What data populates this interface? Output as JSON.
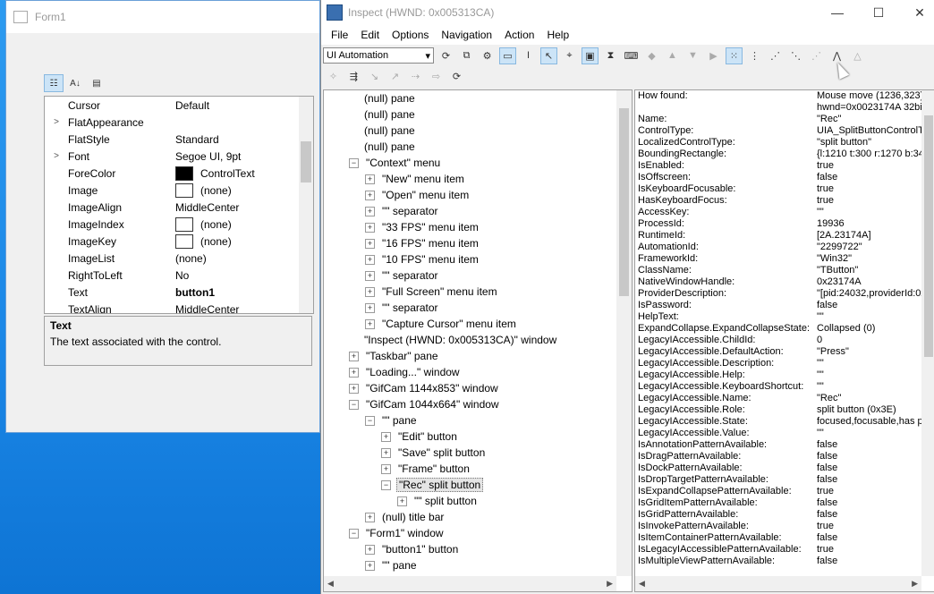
{
  "form1": {
    "title": "Form1",
    "properties": [
      {
        "name": "Cursor",
        "value": "Default",
        "expand": "",
        "swatch": "",
        "bold": false
      },
      {
        "name": "FlatAppearance",
        "value": "",
        "expand": ">",
        "swatch": "",
        "bold": false
      },
      {
        "name": "FlatStyle",
        "value": "Standard",
        "expand": "",
        "swatch": "",
        "bold": false
      },
      {
        "name": "Font",
        "value": "Segoe UI, 9pt",
        "expand": ">",
        "swatch": "",
        "bold": false
      },
      {
        "name": "ForeColor",
        "value": "ControlText",
        "expand": "",
        "swatch": "black",
        "bold": false
      },
      {
        "name": "Image",
        "value": "(none)",
        "expand": "",
        "swatch": "white",
        "bold": false
      },
      {
        "name": "ImageAlign",
        "value": "MiddleCenter",
        "expand": "",
        "swatch": "",
        "bold": false
      },
      {
        "name": "ImageIndex",
        "value": "(none)",
        "expand": "",
        "swatch": "white",
        "bold": false
      },
      {
        "name": "ImageKey",
        "value": "(none)",
        "expand": "",
        "swatch": "white",
        "bold": false
      },
      {
        "name": "ImageList",
        "value": "(none)",
        "expand": "",
        "swatch": "",
        "bold": false
      },
      {
        "name": "RightToLeft",
        "value": "No",
        "expand": "",
        "swatch": "",
        "bold": false
      },
      {
        "name": "Text",
        "value": "button1",
        "expand": "",
        "swatch": "",
        "bold": true
      },
      {
        "name": "TextAlign",
        "value": "MiddleCenter",
        "expand": "",
        "swatch": "",
        "bold": false
      }
    ],
    "description_title": "Text",
    "description_text": "The text associated with the control."
  },
  "inspect": {
    "title": "Inspect  (HWND: 0x005313CA)",
    "menu": [
      "File",
      "Edit",
      "Options",
      "Navigation",
      "Action",
      "Help"
    ],
    "mode": "UI Automation",
    "tree": [
      {
        "indent": 0,
        "exp": "",
        "label": "(null) pane",
        "sel": false
      },
      {
        "indent": 0,
        "exp": "",
        "label": "(null) pane",
        "sel": false
      },
      {
        "indent": 0,
        "exp": "",
        "label": "(null) pane",
        "sel": false
      },
      {
        "indent": 0,
        "exp": "",
        "label": "(null) pane",
        "sel": false
      },
      {
        "indent": 0,
        "exp": "−",
        "label": "\"Context\" menu",
        "sel": false
      },
      {
        "indent": 1,
        "exp": "+",
        "label": "\"New\" menu item",
        "sel": false
      },
      {
        "indent": 1,
        "exp": "+",
        "label": "\"Open\" menu item",
        "sel": false
      },
      {
        "indent": 1,
        "exp": "+",
        "label": "\"\" separator",
        "sel": false
      },
      {
        "indent": 1,
        "exp": "+",
        "label": "\"33 FPS\" menu item",
        "sel": false
      },
      {
        "indent": 1,
        "exp": "+",
        "label": "\"16 FPS\" menu item",
        "sel": false
      },
      {
        "indent": 1,
        "exp": "+",
        "label": "\"10 FPS\" menu item",
        "sel": false
      },
      {
        "indent": 1,
        "exp": "+",
        "label": "\"\" separator",
        "sel": false
      },
      {
        "indent": 1,
        "exp": "+",
        "label": "\"Full Screen\" menu item",
        "sel": false
      },
      {
        "indent": 1,
        "exp": "+",
        "label": "\"\" separator",
        "sel": false
      },
      {
        "indent": 1,
        "exp": "+",
        "label": "\"Capture Cursor\" menu item",
        "sel": false
      },
      {
        "indent": 0,
        "exp": "",
        "label": "\"Inspect  (HWND: 0x005313CA)\" window",
        "sel": false
      },
      {
        "indent": 0,
        "exp": "+",
        "label": "\"Taskbar\" pane",
        "sel": false
      },
      {
        "indent": 0,
        "exp": "+",
        "label": "\"Loading...\" window",
        "sel": false
      },
      {
        "indent": 0,
        "exp": "+",
        "label": "\"GifCam 1144x853\" window",
        "sel": false
      },
      {
        "indent": 0,
        "exp": "−",
        "label": "\"GifCam 1044x664\" window",
        "sel": false
      },
      {
        "indent": 1,
        "exp": "−",
        "label": "\"\" pane",
        "sel": false
      },
      {
        "indent": 2,
        "exp": "+",
        "label": "\"Edit\" button",
        "sel": false
      },
      {
        "indent": 2,
        "exp": "+",
        "label": "\"Save\" split button",
        "sel": false
      },
      {
        "indent": 2,
        "exp": "+",
        "label": "\"Frame\" button",
        "sel": false
      },
      {
        "indent": 2,
        "exp": "−",
        "label": "\"Rec\" split button",
        "sel": true
      },
      {
        "indent": 3,
        "exp": "+",
        "label": "\"\" split button",
        "sel": false
      },
      {
        "indent": 1,
        "exp": "+",
        "label": "(null) title bar",
        "sel": false
      },
      {
        "indent": 0,
        "exp": "−",
        "label": "\"Form1\" window",
        "sel": false
      },
      {
        "indent": 1,
        "exp": "+",
        "label": "\"button1\" button",
        "sel": false
      },
      {
        "indent": 1,
        "exp": "+",
        "label": "\"\" pane",
        "sel": false
      }
    ],
    "props": [
      {
        "k": "How found:",
        "v": "Mouse move (1236,323)"
      },
      {
        "k": "",
        "v": "hwnd=0x0023174A 32bit"
      },
      {
        "k": "Name:",
        "v": "\"Rec\""
      },
      {
        "k": "ControlType:",
        "v": "UIA_SplitButtonControlTy"
      },
      {
        "k": "LocalizedControlType:",
        "v": "\"split button\""
      },
      {
        "k": "BoundingRectangle:",
        "v": "{l:1210 t:300 r:1270 b:34"
      },
      {
        "k": "IsEnabled:",
        "v": "true"
      },
      {
        "k": "IsOffscreen:",
        "v": "false"
      },
      {
        "k": "IsKeyboardFocusable:",
        "v": "true"
      },
      {
        "k": "HasKeyboardFocus:",
        "v": "true"
      },
      {
        "k": "AccessKey:",
        "v": "\"\""
      },
      {
        "k": "ProcessId:",
        "v": "19936"
      },
      {
        "k": "RuntimeId:",
        "v": "[2A.23174A]"
      },
      {
        "k": "AutomationId:",
        "v": "\"2299722\""
      },
      {
        "k": "FrameworkId:",
        "v": "\"Win32\""
      },
      {
        "k": "ClassName:",
        "v": "\"TButton\""
      },
      {
        "k": "NativeWindowHandle:",
        "v": "0x23174A"
      },
      {
        "k": "ProviderDescription:",
        "v": "\"[pid:24032,providerId:0x"
      },
      {
        "k": "IsPassword:",
        "v": "false"
      },
      {
        "k": "HelpText:",
        "v": "\"\""
      },
      {
        "k": "ExpandCollapse.ExpandCollapseState:",
        "v": "Collapsed (0)"
      },
      {
        "k": "LegacyIAccessible.ChildId:",
        "v": "0"
      },
      {
        "k": "LegacyIAccessible.DefaultAction:",
        "v": "\"Press\""
      },
      {
        "k": "LegacyIAccessible.Description:",
        "v": "\"\""
      },
      {
        "k": "LegacyIAccessible.Help:",
        "v": "\"\""
      },
      {
        "k": "LegacyIAccessible.KeyboardShortcut:",
        "v": "\"\""
      },
      {
        "k": "LegacyIAccessible.Name:",
        "v": "\"Rec\""
      },
      {
        "k": "LegacyIAccessible.Role:",
        "v": "split button (0x3E)"
      },
      {
        "k": "LegacyIAccessible.State:",
        "v": "focused,focusable,has p"
      },
      {
        "k": "LegacyIAccessible.Value:",
        "v": "\"\""
      },
      {
        "k": "IsAnnotationPatternAvailable:",
        "v": "false"
      },
      {
        "k": "IsDragPatternAvailable:",
        "v": "false"
      },
      {
        "k": "IsDockPatternAvailable:",
        "v": "false"
      },
      {
        "k": "IsDropTargetPatternAvailable:",
        "v": "false"
      },
      {
        "k": "IsExpandCollapsePatternAvailable:",
        "v": "true"
      },
      {
        "k": "IsGridItemPatternAvailable:",
        "v": "false"
      },
      {
        "k": "IsGridPatternAvailable:",
        "v": "false"
      },
      {
        "k": "IsInvokePatternAvailable:",
        "v": "true"
      },
      {
        "k": "IsItemContainerPatternAvailable:",
        "v": "false"
      },
      {
        "k": "IsLegacyIAccessiblePatternAvailable:",
        "v": "true"
      },
      {
        "k": "IsMultipleViewPatternAvailable:",
        "v": "false"
      }
    ]
  }
}
